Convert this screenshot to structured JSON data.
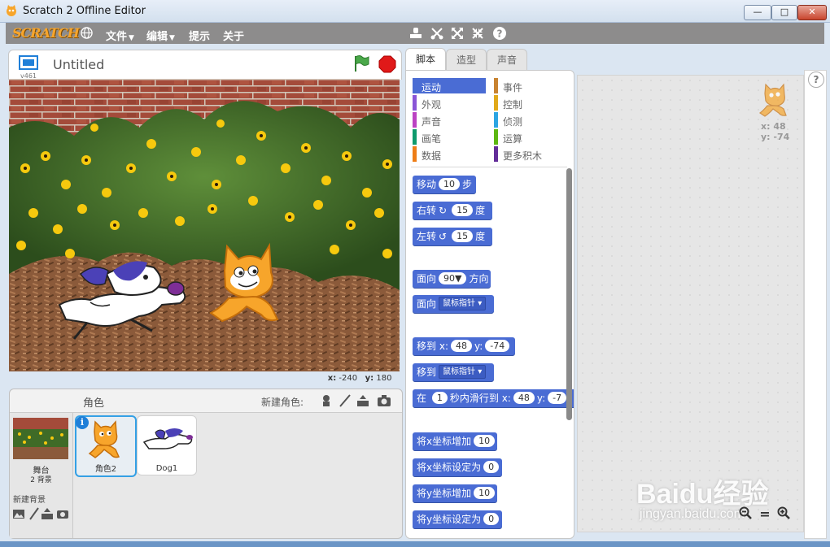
{
  "window": {
    "title": "Scratch 2 Offline Editor",
    "minimize": "—",
    "maximize": "□",
    "close": "✕"
  },
  "menubar": {
    "logo": "SCRATCH",
    "menus": [
      {
        "label": "文件",
        "caret": "▼"
      },
      {
        "label": "编辑",
        "caret": "▼"
      },
      {
        "label": "提示"
      },
      {
        "label": "关于"
      }
    ]
  },
  "stage": {
    "version": "v461",
    "project_title": "Untitled",
    "mouse_x_label": "x:",
    "mouse_x": "-240",
    "mouse_y_label": "y:",
    "mouse_y": "180"
  },
  "sprites_pane": {
    "header_label": "角色",
    "new_sprite_label": "新建角色:",
    "stage_name": "舞台",
    "stage_backdrops": "2 背景",
    "new_backdrop_label": "新建背景",
    "sprites": [
      {
        "name": "角色2",
        "selected": true,
        "info": "i"
      },
      {
        "name": "Dog1",
        "selected": false
      }
    ]
  },
  "tabs": [
    {
      "label": "脚本",
      "active": true
    },
    {
      "label": "造型",
      "active": false
    },
    {
      "label": "声音",
      "active": false
    }
  ],
  "categories": [
    {
      "label": "运动",
      "color": "#4a6cd4",
      "selected": true
    },
    {
      "label": "事件",
      "color": "#c88330"
    },
    {
      "label": "外观",
      "color": "#8a55d7"
    },
    {
      "label": "控制",
      "color": "#e1a91a"
    },
    {
      "label": "声音",
      "color": "#bb42c3"
    },
    {
      "label": "侦测",
      "color": "#2ca5e2"
    },
    {
      "label": "画笔",
      "color": "#0e9a6c"
    },
    {
      "label": "运算",
      "color": "#5cb712"
    },
    {
      "label": "数据",
      "color": "#ee7d16"
    },
    {
      "label": "更多积木",
      "color": "#632d99"
    }
  ],
  "blocks": {
    "move": {
      "pre": "移动",
      "value": "10",
      "post": "步"
    },
    "turn_right": {
      "pre": "右转",
      "icon": "↻",
      "value": "15",
      "post": "度"
    },
    "turn_left": {
      "pre": "左转",
      "icon": "↺",
      "value": "15",
      "post": "度"
    },
    "point_dir": {
      "pre": "面向",
      "value": "90▼",
      "post": "方向"
    },
    "point_towards": {
      "pre": "面向",
      "dropdown": "鼠标指针 ▾"
    },
    "goto_xy": {
      "pre": "移到",
      "x_label": "x:",
      "x": "48",
      "y_label": "y:",
      "y": "-74"
    },
    "goto_target": {
      "pre": "移到",
      "dropdown": "鼠标指针 ▾"
    },
    "glide": {
      "pre": "在",
      "secs": "1",
      "mid": "秒内滑行到",
      "x_label": "x:",
      "x": "48",
      "y_label": "y:",
      "y": "-7"
    },
    "change_x": {
      "label": "将x坐标增加",
      "value": "10"
    },
    "set_x": {
      "label": "将x坐标设定为",
      "value": "0"
    },
    "change_y": {
      "label": "将y坐标增加",
      "value": "10"
    },
    "set_y": {
      "label": "将y坐标设定为",
      "value": "0"
    }
  },
  "scripts_area": {
    "sprite_x_label": "x:",
    "sprite_x": "48",
    "sprite_y_label": "y:",
    "sprite_y": "-74",
    "help": "?"
  },
  "zoom": {
    "out": "🔍",
    "reset": "=",
    "in": "🔍"
  },
  "watermark": {
    "brand": "Baidu经验",
    "url": "jingyan.baidu.com"
  }
}
